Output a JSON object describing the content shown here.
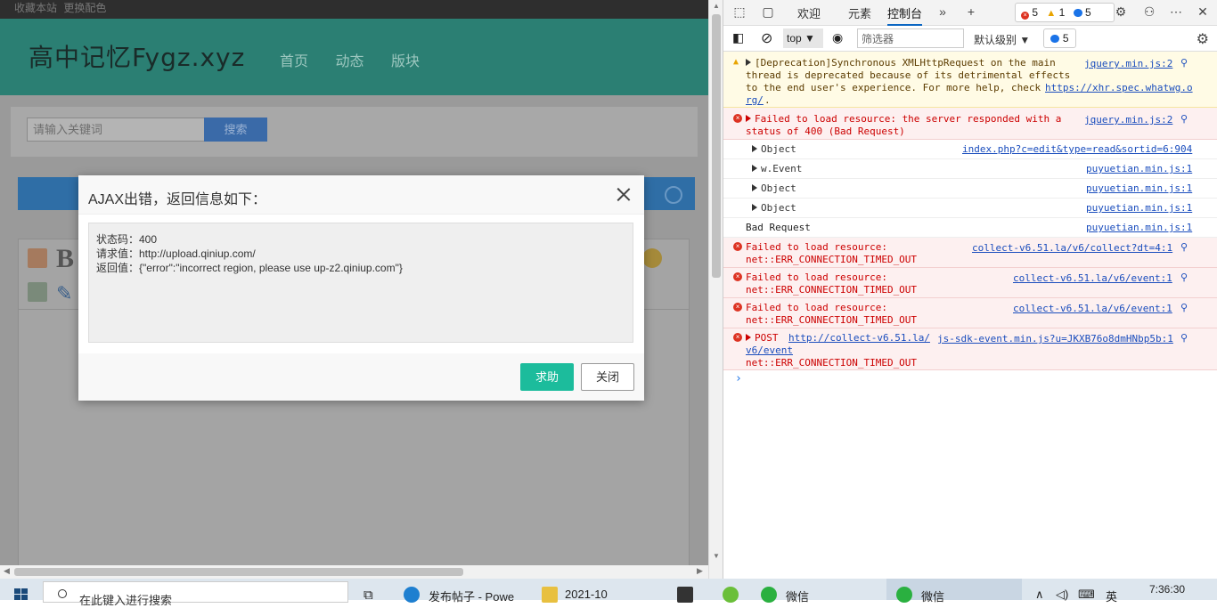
{
  "page": {
    "topbar": {
      "bookmark": "收藏本站",
      "color": "更换配色"
    },
    "logo": "高中记忆Fygz.xyz",
    "nav": [
      "首页",
      "动态",
      "版块"
    ],
    "search": {
      "placeholder": "请输入关键词",
      "button": "搜索"
    }
  },
  "dialog": {
    "title": "AJAX出错，返回信息如下：",
    "lines": [
      "状态码：400",
      "请求值：http://upload.qiniup.com/",
      "返回值：{\"error\":\"incorrect region, please use up-z2.qiniup.com\"}"
    ],
    "help_button": "求助",
    "close_button": "关闭"
  },
  "devtools": {
    "tabs": [
      "欢迎",
      "元素",
      "控制台"
    ],
    "active_tab": "控制台",
    "badges": {
      "errors": "5",
      "warnings": "1",
      "messages": "5"
    },
    "context": "top",
    "filter_placeholder": "筛选器",
    "level": "默认级别",
    "message_count": "5",
    "rows": [
      {
        "type": "warn",
        "text": "[Deprecation]Synchronous XMLHttpRequest on the main\nthread is deprecated because of its detrimental effects\nto the end user's experience. For more help, check ",
        "link": "https://xhr.spec.whatwg.o",
        "link2": "rg/",
        "after": ".",
        "src": "jquery.min.js:2"
      },
      {
        "type": "error",
        "text": "Failed to load resource: the server responded with a\nstatus of 400 (Bad Request)",
        "src": "jquery.min.js:2"
      },
      {
        "type": "log",
        "text": "Object",
        "src": "index.php?c=edit&type=read&sortid=6:904"
      },
      {
        "type": "log",
        "text": "w.Event",
        "src": "puyuetian.min.js:1"
      },
      {
        "type": "log",
        "text": "Object",
        "src": "puyuetian.min.js:1"
      },
      {
        "type": "log",
        "text": "Object",
        "src": "puyuetian.min.js:1"
      },
      {
        "type": "plain",
        "text": "Bad Request",
        "src": "puyuetian.min.js:1"
      },
      {
        "type": "error",
        "text": "Failed to load resource:\nnet::ERR_CONNECTION_TIMED_OUT",
        "src": "collect-v6.51.la/v6/collect?dt=4:1"
      },
      {
        "type": "error",
        "text": "Failed to load resource:\nnet::ERR_CONNECTION_TIMED_OUT",
        "src": "collect-v6.51.la/v6/event:1"
      },
      {
        "type": "error",
        "text": "Failed to load resource:\nnet::ERR_CONNECTION_TIMED_OUT",
        "src": "collect-v6.51.la/v6/event:1"
      },
      {
        "type": "error",
        "method": "POST",
        "link": "http://collect-v6.51.la/",
        "link2": "v6/event",
        "text2": "net::ERR_CONNECTION_TIMED_OUT",
        "src": "js-sdk-event.min.js?u=JKXB76o8dmHNbp5b:1"
      }
    ]
  },
  "taskbar": {
    "search_placeholder": "在此键入进行搜索",
    "items": [
      "发布帖子 - Powe",
      "2021-10",
      "微信",
      "微信"
    ],
    "ime": "英",
    "time": "7:36:30"
  },
  "colors": {
    "accent_teal": "#1cbc9c",
    "header_green": "#2b7f73",
    "error_red": "#cc0000"
  }
}
